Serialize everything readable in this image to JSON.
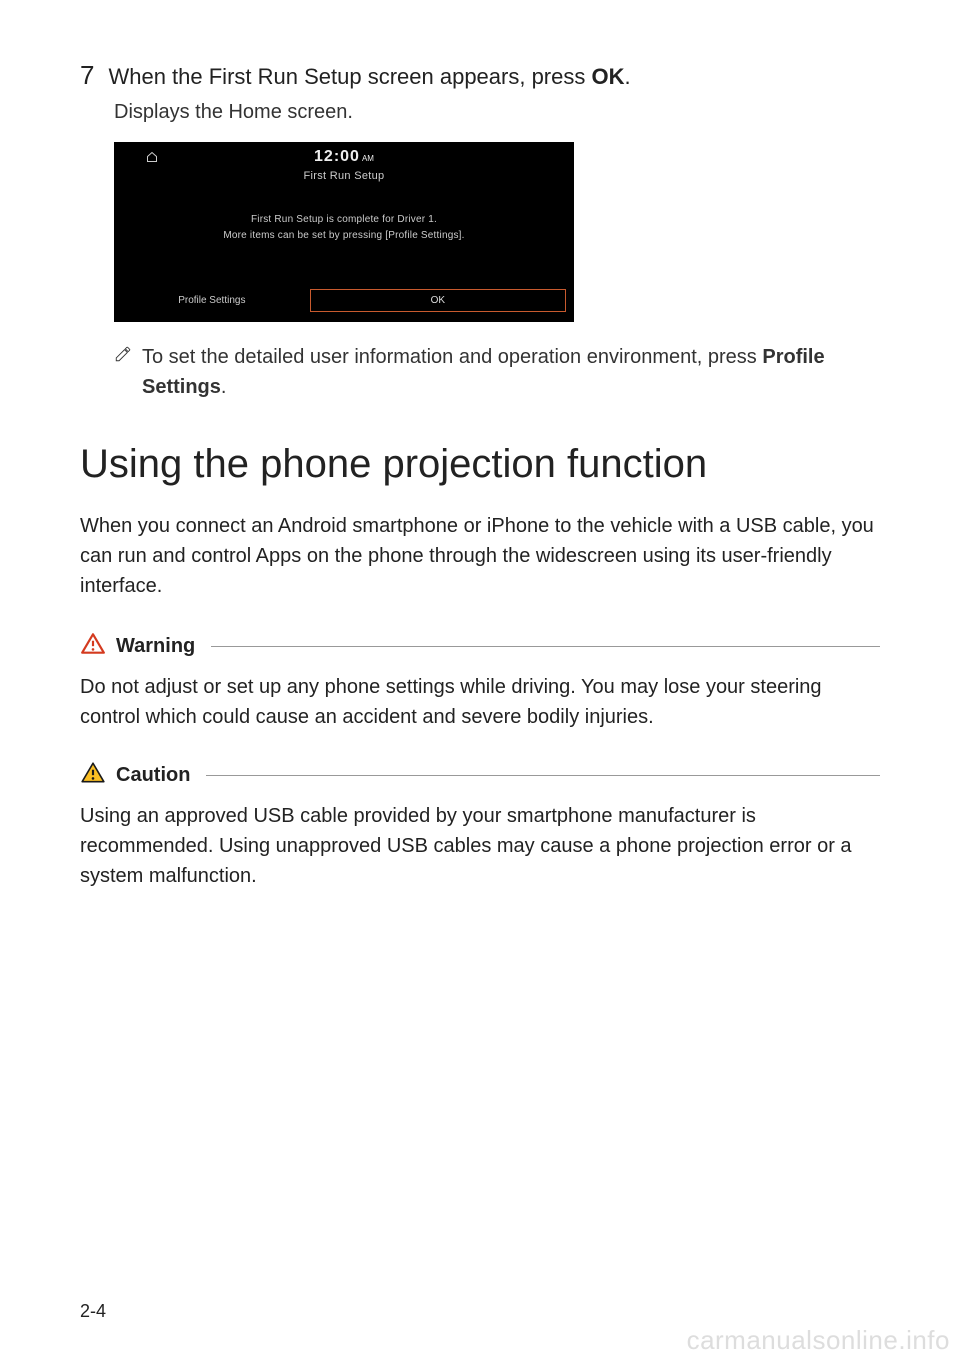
{
  "step": {
    "num": "7",
    "text_prefix": "When the First Run Setup screen appears, press ",
    "text_bold": "OK",
    "text_suffix": ".",
    "desc": "Displays the Home screen."
  },
  "screenshot": {
    "time": "12:00",
    "ampm": "AM",
    "title": "First Run Setup",
    "body_line1": "First Run Setup is complete for Driver 1.",
    "body_line2": "More items can be set by pressing [Profile Settings].",
    "btn_left": "Profile Settings",
    "btn_right": "OK"
  },
  "note": {
    "text_prefix": "To set the detailed user information and operation environment, press ",
    "text_bold": "Profile Settings",
    "text_suffix": "."
  },
  "section": {
    "heading": "Using the phone projection function",
    "intro": "When you connect an Android smartphone or iPhone to the vehicle with a USB cable, you can run and control Apps on the phone through the widescreen using its user-friendly interface."
  },
  "warning": {
    "label": "Warning",
    "body": "Do not adjust or set up any phone settings while driving. You may lose your steering control which could cause an accident and severe bodily injuries."
  },
  "caution": {
    "label": "Caution",
    "body": "Using an approved USB cable provided by your smartphone manufacturer is recommended. Using unapproved USB cables may cause a phone projection error or a system malfunction."
  },
  "footer": {
    "page": "2-4",
    "watermark": "carmanualsonline.info"
  }
}
